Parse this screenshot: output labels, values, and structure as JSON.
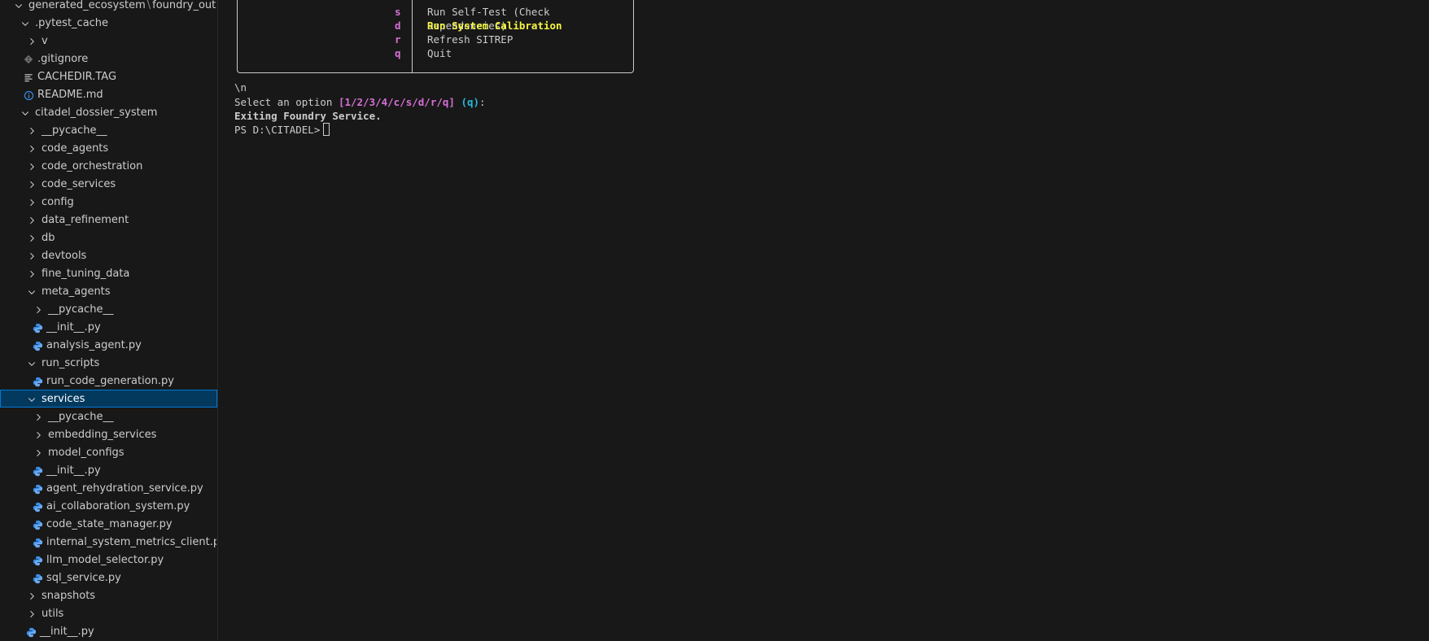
{
  "explorer": {
    "breadcrumb": {
      "folder": "generated_ecosystem",
      "separator": "\\",
      "subfolder": "foundry_output"
    },
    "items": [
      {
        "label": "generated_ecosystem \\ foundry_output",
        "type": "folder-open",
        "depth": 0
      },
      {
        "label": ".pytest_cache",
        "type": "folder-open",
        "depth": 1
      },
      {
        "label": "v",
        "type": "folder-closed",
        "depth": 2
      },
      {
        "label": ".gitignore",
        "type": "file-git",
        "depth": 2
      },
      {
        "label": "CACHEDIR.TAG",
        "type": "file-text",
        "depth": 2
      },
      {
        "label": "README.md",
        "type": "file-info",
        "depth": 2
      },
      {
        "label": "citadel_dossier_system",
        "type": "folder-open",
        "depth": 1
      },
      {
        "label": "__pycache__",
        "type": "folder-closed",
        "depth": 2
      },
      {
        "label": "code_agents",
        "type": "folder-closed",
        "depth": 2
      },
      {
        "label": "code_orchestration",
        "type": "folder-closed",
        "depth": 2
      },
      {
        "label": "code_services",
        "type": "folder-closed",
        "depth": 2
      },
      {
        "label": "config",
        "type": "folder-closed",
        "depth": 2
      },
      {
        "label": "data_refinement",
        "type": "folder-closed",
        "depth": 2
      },
      {
        "label": "db",
        "type": "folder-closed",
        "depth": 2
      },
      {
        "label": "devtools",
        "type": "folder-closed",
        "depth": 2
      },
      {
        "label": "fine_tuning_data",
        "type": "folder-closed",
        "depth": 2
      },
      {
        "label": "meta_agents",
        "type": "folder-open",
        "depth": 2
      },
      {
        "label": "__pycache__",
        "type": "folder-closed",
        "depth": 3
      },
      {
        "label": "__init__.py",
        "type": "file-python",
        "depth": 3
      },
      {
        "label": "analysis_agent.py",
        "type": "file-python",
        "depth": 3
      },
      {
        "label": "run_scripts",
        "type": "folder-open",
        "depth": 2
      },
      {
        "label": "run_code_generation.py",
        "type": "file-python",
        "depth": 3
      },
      {
        "label": "services",
        "type": "folder-open",
        "depth": 2,
        "selected": true
      },
      {
        "label": "__pycache__",
        "type": "folder-closed",
        "depth": 3
      },
      {
        "label": "embedding_services",
        "type": "folder-closed",
        "depth": 3
      },
      {
        "label": "model_configs",
        "type": "folder-closed",
        "depth": 3
      },
      {
        "label": "__init__.py",
        "type": "file-python",
        "depth": 3
      },
      {
        "label": "agent_rehydration_service.py",
        "type": "file-python",
        "depth": 3
      },
      {
        "label": "ai_collaboration_system.py",
        "type": "file-python",
        "depth": 3
      },
      {
        "label": "code_state_manager.py",
        "type": "file-python",
        "depth": 3
      },
      {
        "label": "internal_system_metrics_client.py",
        "type": "file-python",
        "depth": 3
      },
      {
        "label": "llm_model_selector.py",
        "type": "file-python",
        "depth": 3
      },
      {
        "label": "sql_service.py",
        "type": "file-python",
        "depth": 3
      },
      {
        "label": "snapshots",
        "type": "folder-closed",
        "depth": 2
      },
      {
        "label": "utils",
        "type": "folder-closed",
        "depth": 2
      },
      {
        "label": "__init__.py",
        "type": "file-python",
        "depth": 2
      }
    ]
  },
  "terminal": {
    "menu": [
      {
        "key": "s",
        "desc": "Run Self-Test (Check Dependencies)",
        "highlight": false
      },
      {
        "key": "d",
        "desc": "Run System Calibration",
        "highlight": true
      },
      {
        "key": "r",
        "desc": "Refresh SITREP",
        "highlight": false
      },
      {
        "key": "q",
        "desc": "Quit",
        "highlight": false
      }
    ],
    "newline_literal": "\\n",
    "prompt_text": "Select an option ",
    "prompt_choices": "[1/2/3/4/c/s/d/r/q]",
    "prompt_default": "(q)",
    "prompt_colon": ":",
    "exit_message": "Exiting Foundry Service.",
    "shell_prompt": "PS D:\\CITADEL>"
  },
  "colors": {
    "background": "#181818",
    "text": "#cccccc",
    "magenta": "#d670d6",
    "yellow": "#f5f543",
    "cyan": "#29b8db",
    "selection": "#04395e",
    "selection_border": "#0078d4",
    "python_icon": "#3b8eea"
  }
}
